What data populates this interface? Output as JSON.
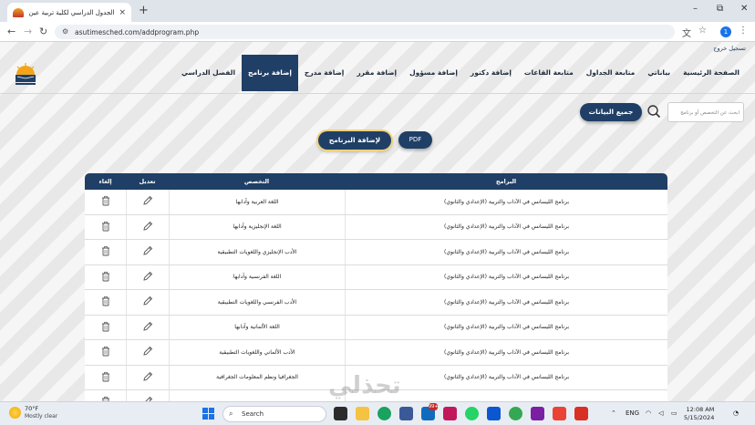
{
  "browser": {
    "tab_title": "الجدول الدراسي لكلية تربية عين ش",
    "tab_close": "×",
    "new_tab": "+",
    "url": "asutimesched.com/addprogram.php",
    "profile_initial": "1",
    "win_min": "–",
    "win_max": "⧉",
    "win_close": "✕"
  },
  "header": {
    "logout": "تسجيل خروج",
    "nav": [
      {
        "label": "الصفحة الرئيسية",
        "active": false
      },
      {
        "label": "بياناتي",
        "active": false
      },
      {
        "label": "متابعة الجداول",
        "active": false
      },
      {
        "label": "متابعة القاعات",
        "active": false
      },
      {
        "label": "إضافة دكتور",
        "active": false
      },
      {
        "label": "إضافة مسؤول",
        "active": false
      },
      {
        "label": "إضافة مقرر",
        "active": false
      },
      {
        "label": "إضافة مدرج",
        "active": false
      },
      {
        "label": "إضافة برنامج",
        "active": true
      },
      {
        "label": "الفصل الدراسي",
        "active": false
      }
    ]
  },
  "toolbar": {
    "search_placeholder": "ابحث عن التخصص أو برنامج",
    "all_data_label": "جميع البيانات",
    "pdf_label": "PDF",
    "add_program_label": "لإضافة البرنامج"
  },
  "table": {
    "headers": {
      "program": "البرامج",
      "specialization": "التخصص",
      "edit": "تعديل",
      "cancel": "إلغاء"
    },
    "rows": [
      {
        "program": "برنامج الليسانس في الآداب والتربية (الإعدادي والثانوي)",
        "specialization": "اللغة العربية وآدابها"
      },
      {
        "program": "برنامج الليسانس في الآداب والتربية (الإعدادي والثانوي)",
        "specialization": "اللغة الإنجليزية وآدابها"
      },
      {
        "program": "برنامج الليسانس في الآداب والتربية (الإعدادي والثانوي)",
        "specialization": "الأدب الإنجليزي واللغويات التطبيقية"
      },
      {
        "program": "برنامج الليسانس في الآداب والتربية (الإعدادي والثانوي)",
        "specialization": "اللغة الفرنسية وآدابها"
      },
      {
        "program": "برنامج الليسانس في الآداب والتربية (الإعدادي والثانوي)",
        "specialization": "الأدب الفرنسي واللغويات التطبيقية"
      },
      {
        "program": "برنامج الليسانس في الآداب والتربية (الإعدادي والثانوي)",
        "specialization": "اللغة الألمانية وآدابها"
      },
      {
        "program": "برنامج الليسانس في الآداب والتربية (الإعدادي والثانوي)",
        "specialization": "الأدب الألماني واللغويات التطبيقية"
      },
      {
        "program": "برنامج الليسانس في الآداب والتربية (الإعدادي والثانوي)",
        "specialization": "الجغرافيا ونظم المعلومات الجغرافية"
      },
      {
        "program": "",
        "specialization": ""
      }
    ]
  },
  "watermark": "تحذلي",
  "taskbar": {
    "temp": "70°F",
    "weather": "Mostly clear",
    "search_label": "Search",
    "badge_count": "99+",
    "lang": "ENG",
    "time": "12:08 AM",
    "date": "5/15/2024"
  },
  "colors": {
    "primary": "#1f3f66",
    "accent": "#f0d07a"
  }
}
